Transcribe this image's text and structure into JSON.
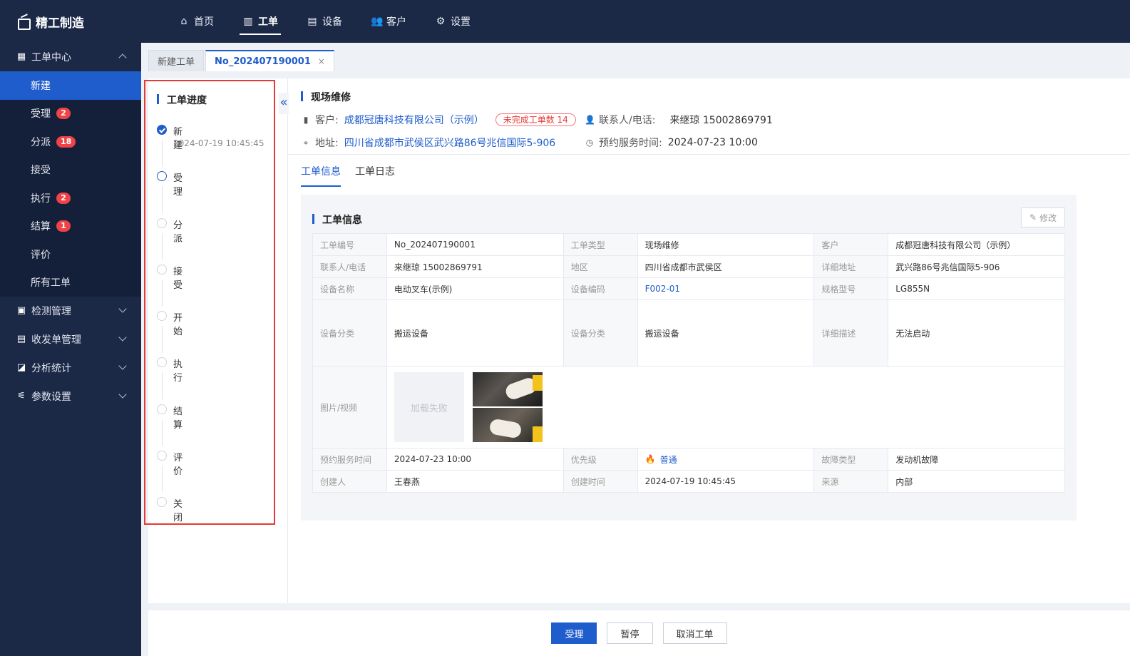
{
  "app": {
    "title": "精工制造"
  },
  "topnav": [
    {
      "label": "首页",
      "icon": "home-icon",
      "glyph": "⌂",
      "active": false
    },
    {
      "label": "工单",
      "icon": "work-order-icon",
      "glyph": "▥",
      "active": true
    },
    {
      "label": "设备",
      "icon": "equipment-icon",
      "glyph": "▤",
      "active": false
    },
    {
      "label": "客户",
      "icon": "customer-icon",
      "glyph": "👥",
      "active": false
    },
    {
      "label": "设置",
      "icon": "gear-icon",
      "glyph": "⚙",
      "active": false
    }
  ],
  "sidebar": {
    "group_main": {
      "label": "工单中心",
      "icon": "document-icon",
      "glyph": "▦"
    },
    "items": [
      {
        "label": "新建",
        "badge": "",
        "active": true
      },
      {
        "label": "受理",
        "badge": "2",
        "active": false
      },
      {
        "label": "分派",
        "badge": "18",
        "active": false
      },
      {
        "label": "接受",
        "badge": "",
        "active": false
      },
      {
        "label": "执行",
        "badge": "2",
        "active": false
      },
      {
        "label": "结算",
        "badge": "1",
        "active": false
      },
      {
        "label": "评价",
        "badge": "",
        "active": false
      },
      {
        "label": "所有工单",
        "badge": "",
        "active": false
      }
    ],
    "groups": [
      {
        "label": "检测管理",
        "icon": "monitor-icon",
        "glyph": "▣"
      },
      {
        "label": "收发单管理",
        "icon": "receipt-icon",
        "glyph": "▤"
      },
      {
        "label": "分析统计",
        "icon": "chart-icon",
        "glyph": "◪"
      },
      {
        "label": "参数设置",
        "icon": "sliders-icon",
        "glyph": "⚟"
      }
    ]
  },
  "tabs": [
    {
      "label": "新建工单",
      "active": false
    },
    {
      "label": "No_202407190001",
      "active": true,
      "close": "×"
    }
  ],
  "progress": {
    "title": "工单进度",
    "steps": [
      {
        "label": "新建",
        "time": "2024-07-19 10:45:45",
        "state": "done"
      },
      {
        "label": "受理",
        "time": "",
        "state": "current"
      },
      {
        "label": "分派",
        "time": "",
        "state": "pending"
      },
      {
        "label": "接受",
        "time": "",
        "state": "pending"
      },
      {
        "label": "开始",
        "time": "",
        "state": "pending"
      },
      {
        "label": "执行",
        "time": "",
        "state": "pending"
      },
      {
        "label": "结算",
        "time": "",
        "state": "pending"
      },
      {
        "label": "评价",
        "time": "",
        "state": "pending"
      },
      {
        "label": "关闭",
        "time": "",
        "state": "pending"
      }
    ],
    "collapse_glyph": "«"
  },
  "header": {
    "title": "现场维修",
    "customer_label": "客户:",
    "customer_value": "成都冠唐科技有限公司（示例）",
    "pending_tag": "未完成工单数 14",
    "contact_label": "联系人/电话:",
    "contact_value": "来继琼 15002869791",
    "address_label": "地址:",
    "address_value": "四川省成都市武侯区武兴路86号兆信国际5-906",
    "schedule_label": "预约服务时间:",
    "schedule_value": "2024-07-23 10:00"
  },
  "sub_tabs": [
    {
      "label": "工单信息",
      "active": true
    },
    {
      "label": "工单日志",
      "active": false
    }
  ],
  "detail": {
    "title": "工单信息",
    "edit_label": "修改",
    "rows": {
      "r1": {
        "k1": "工单编号",
        "v1": "No_202407190001",
        "k2": "工单类型",
        "v2": "现场维修",
        "k3": "客户",
        "v3": "成都冠唐科技有限公司（示例）"
      },
      "r2": {
        "k1": "联系人/电话",
        "v1": "来继琼 15002869791",
        "k2": "地区",
        "v2": "四川省成都市武侯区",
        "k3": "详细地址",
        "v3": "武兴路86号兆信国际5-906"
      },
      "r3": {
        "k1": "设备名称",
        "v1": "电动叉车(示例)",
        "k2": "设备编码",
        "v2": "F002-01",
        "k3": "规格型号",
        "v3": "LG855N"
      },
      "r4": {
        "k1": "设备分类",
        "v1": "搬运设备",
        "k2": "设备分类",
        "v2": "搬运设备",
        "k3": "详细描述",
        "v3": "无法启动"
      },
      "r5": {
        "k1": "图片/视频",
        "fail": "加载失败"
      },
      "r6": {
        "k1": "预约服务时间",
        "v1": "2024-07-23 10:00",
        "k2": "优先级",
        "v2": "普通",
        "k3": "故障类型",
        "v3": "发动机故障"
      },
      "r7": {
        "k1": "创建人",
        "v1": "王春燕",
        "k2": "创建时间",
        "v2": "2024-07-19 10:45:45",
        "k3": "来源",
        "v3": "内部"
      }
    }
  },
  "footer": {
    "accept_label": "受理",
    "pause_label": "暂停",
    "cancel_label": "取消工单"
  },
  "colors": {
    "primary": "#1f5ccc",
    "nav_bg": "#1b2846",
    "badge": "#f04347",
    "highlight": "#e53935"
  }
}
